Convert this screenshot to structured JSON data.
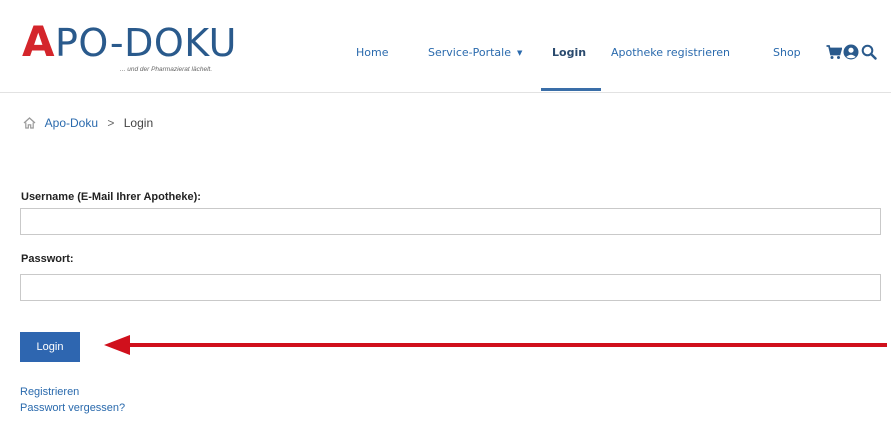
{
  "header": {
    "logo_text": "APO-DOKU",
    "logo_tagline": "... und der Pharmazierat lächelt.",
    "nav": [
      {
        "label": "Home"
      },
      {
        "label": "Service-Portale"
      },
      {
        "label": "Login"
      },
      {
        "label": "Apotheke registrieren"
      },
      {
        "label": "Shop"
      }
    ],
    "icons": [
      "cart-icon",
      "user-icon",
      "search-icon"
    ]
  },
  "breadcrumb": {
    "home": "Apo-Doku",
    "separator": ">",
    "current": "Login"
  },
  "form": {
    "username_label": "Username (E-Mail Ihrer Apotheke):",
    "username_value": "",
    "password_label": "Passwort:",
    "password_value": "",
    "login_button": "Login"
  },
  "links": {
    "register": "Registrieren",
    "forgot_password": "Passwort vergessen?"
  },
  "colors": {
    "brand_red": "#d4252b",
    "brand_blue": "#2a5a8c",
    "link_blue": "#2a6aad",
    "button_blue": "#2e66b0",
    "annotation_arrow": "#d0101c"
  }
}
